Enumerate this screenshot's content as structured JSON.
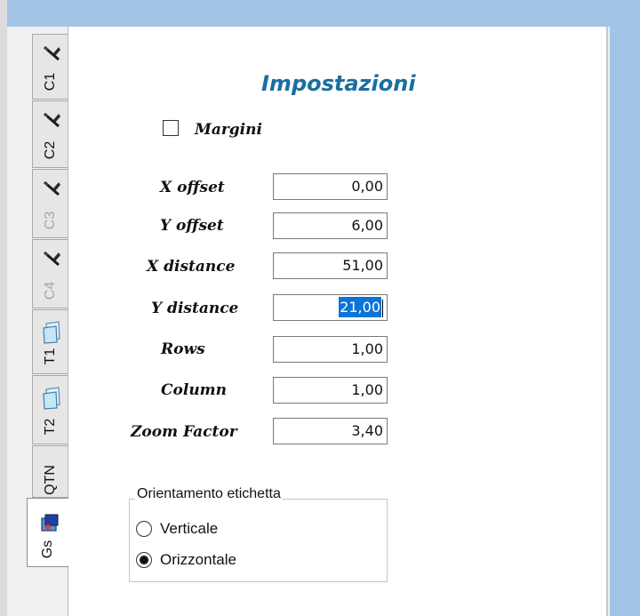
{
  "tabs": [
    {
      "label": "C1",
      "icon": "pen-icon",
      "enabled": true
    },
    {
      "label": "C2",
      "icon": "pen-icon",
      "enabled": true
    },
    {
      "label": "C3",
      "icon": "pen-icon",
      "enabled": false
    },
    {
      "label": "C4",
      "icon": "pen-icon",
      "enabled": false
    },
    {
      "label": "T1",
      "icon": "document-icon",
      "enabled": true
    },
    {
      "label": "T2",
      "icon": "document-icon",
      "enabled": true
    },
    {
      "label": "QTN",
      "icon": "",
      "enabled": true
    },
    {
      "label": "Gs",
      "icon": "settings-icon",
      "enabled": true,
      "selected": true
    }
  ],
  "settings": {
    "title": "Impostazioni",
    "margins_label": "Margini",
    "margins_checked": false,
    "fields": [
      {
        "label": "X offset",
        "value": "0,00"
      },
      {
        "label": "Y offset",
        "value": "6,00"
      },
      {
        "label": "X distance",
        "value": "51,00"
      },
      {
        "label": "Y distance",
        "value": "21,00"
      },
      {
        "label": "Rows",
        "value": "1,00"
      },
      {
        "label": "Column",
        "value": "1,00"
      },
      {
        "label": "Zoom Factor",
        "value": "3,40"
      }
    ]
  },
  "orientation": {
    "group_label": "Orientamento etichetta",
    "options": [
      {
        "label": "Verticale",
        "selected": false
      },
      {
        "label": "Orizzontale",
        "selected": true
      }
    ]
  },
  "colors": {
    "title": "#1a6f9f",
    "selection": "#0a74d7",
    "background": "#a2c4e6"
  }
}
